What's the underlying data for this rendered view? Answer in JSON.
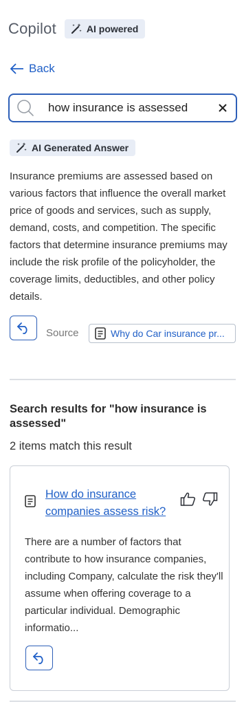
{
  "header": {
    "title": "Copilot",
    "badge_label": "AI powered"
  },
  "back": {
    "label": "Back"
  },
  "search": {
    "value": "how insurance is assessed",
    "placeholder": ""
  },
  "ai_answer": {
    "badge_label": "AI Generated Answer",
    "text": "Insurance premiums are assessed based on various factors that influence the overall market price of goods and services, such as supply, demand, costs, and competition. The specific factors that determine insurance premiums may include the risk profile of the policyholder, the coverage limits, deductibles, and other policy details.",
    "source_label": "Source",
    "source_title": "Why do Car insurance pr..."
  },
  "results": {
    "title": "Search results for \"how insurance is assessed\"",
    "count_text": "2 items match this result",
    "items": [
      {
        "title": "How do insurance companies assess risk?",
        "snippet": "There are a number of factors that contribute to how insurance companies, including Company, calculate the risk they'll assume when offering coverage to a particular individual. Demographic informatio..."
      }
    ]
  },
  "colors": {
    "accent": "#1f5fc7",
    "border_accent": "#2d5fb8",
    "badge_bg": "#e8edf6"
  },
  "icons": {
    "ai_badge": "magic-wand-icon",
    "back": "arrow-left-icon",
    "search": "search-icon",
    "clear": "close-icon",
    "reply": "reply-arrow-icon",
    "document": "document-icon",
    "thumbs_up": "thumbs-up-icon",
    "thumbs_down": "thumbs-down-icon"
  }
}
